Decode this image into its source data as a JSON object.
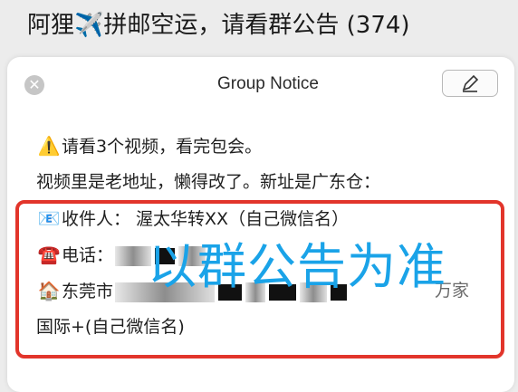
{
  "chat": {
    "title": "阿狸✈️拼邮空运，请看群公告 (374)"
  },
  "notice": {
    "title": "Group Notice",
    "lines": {
      "warning": "请看3个视频，看完包会。",
      "old_address": "视频里是老地址，懒得改了。新址是广东仓：",
      "recipient": "收件人：  渥太华转XX（自己微信名）",
      "phone": "电话：",
      "city": "东莞市",
      "city_suffix": "万家",
      "last": "国际+(自己微信名)"
    },
    "icons": {
      "warning": "⚠️",
      "recipient": "📧",
      "phone": "☎️",
      "city": "🏠"
    }
  },
  "overlay": {
    "text": "以群公告为准"
  },
  "colors": {
    "highlight_box": "#e2352b",
    "overlay_text": "#1aa3e8"
  }
}
